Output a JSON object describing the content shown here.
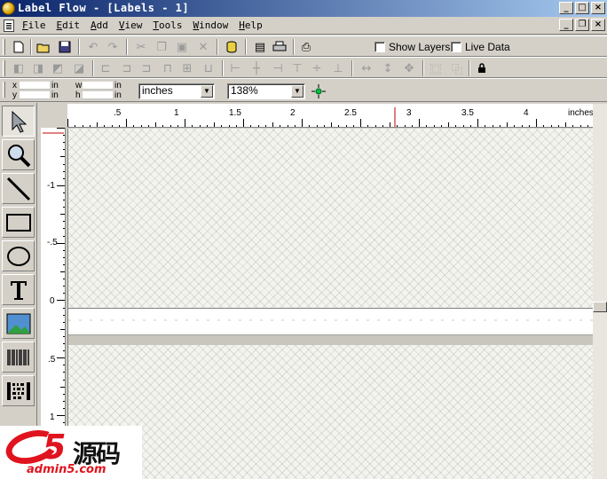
{
  "window": {
    "title": "Label Flow - [Labels - 1]",
    "controls": [
      "_",
      "□",
      "×"
    ],
    "child_controls": [
      "_",
      "❐",
      "×"
    ]
  },
  "menu": [
    "File",
    "Edit",
    "Add",
    "View",
    "Tools",
    "Window",
    "Help"
  ],
  "toolbar": {
    "show_layers": "Show Layers",
    "live_data": "Live Data"
  },
  "position": {
    "x_label": "x",
    "y_label": "y",
    "w_label": "w",
    "h_label": "h",
    "unit_in": "in",
    "units_select": "inches",
    "zoom_select": "138%"
  },
  "ruler": {
    "h_labels": [
      ".5",
      "1",
      "1.5",
      "2",
      "2.5",
      "3",
      "3.5",
      "4",
      "inches"
    ],
    "v_labels": [
      "-1",
      "-.5",
      "0",
      ".5",
      "1"
    ]
  },
  "watermark": {
    "brand_5": "5",
    "brand_cn": "源码",
    "url": "admin5.com"
  },
  "colors": {
    "title_start": "#0a246a",
    "title_end": "#a6caf0",
    "chrome": "#d4d0c8",
    "ruler_marker": "#c00000",
    "brand_red": "#e0141e"
  }
}
